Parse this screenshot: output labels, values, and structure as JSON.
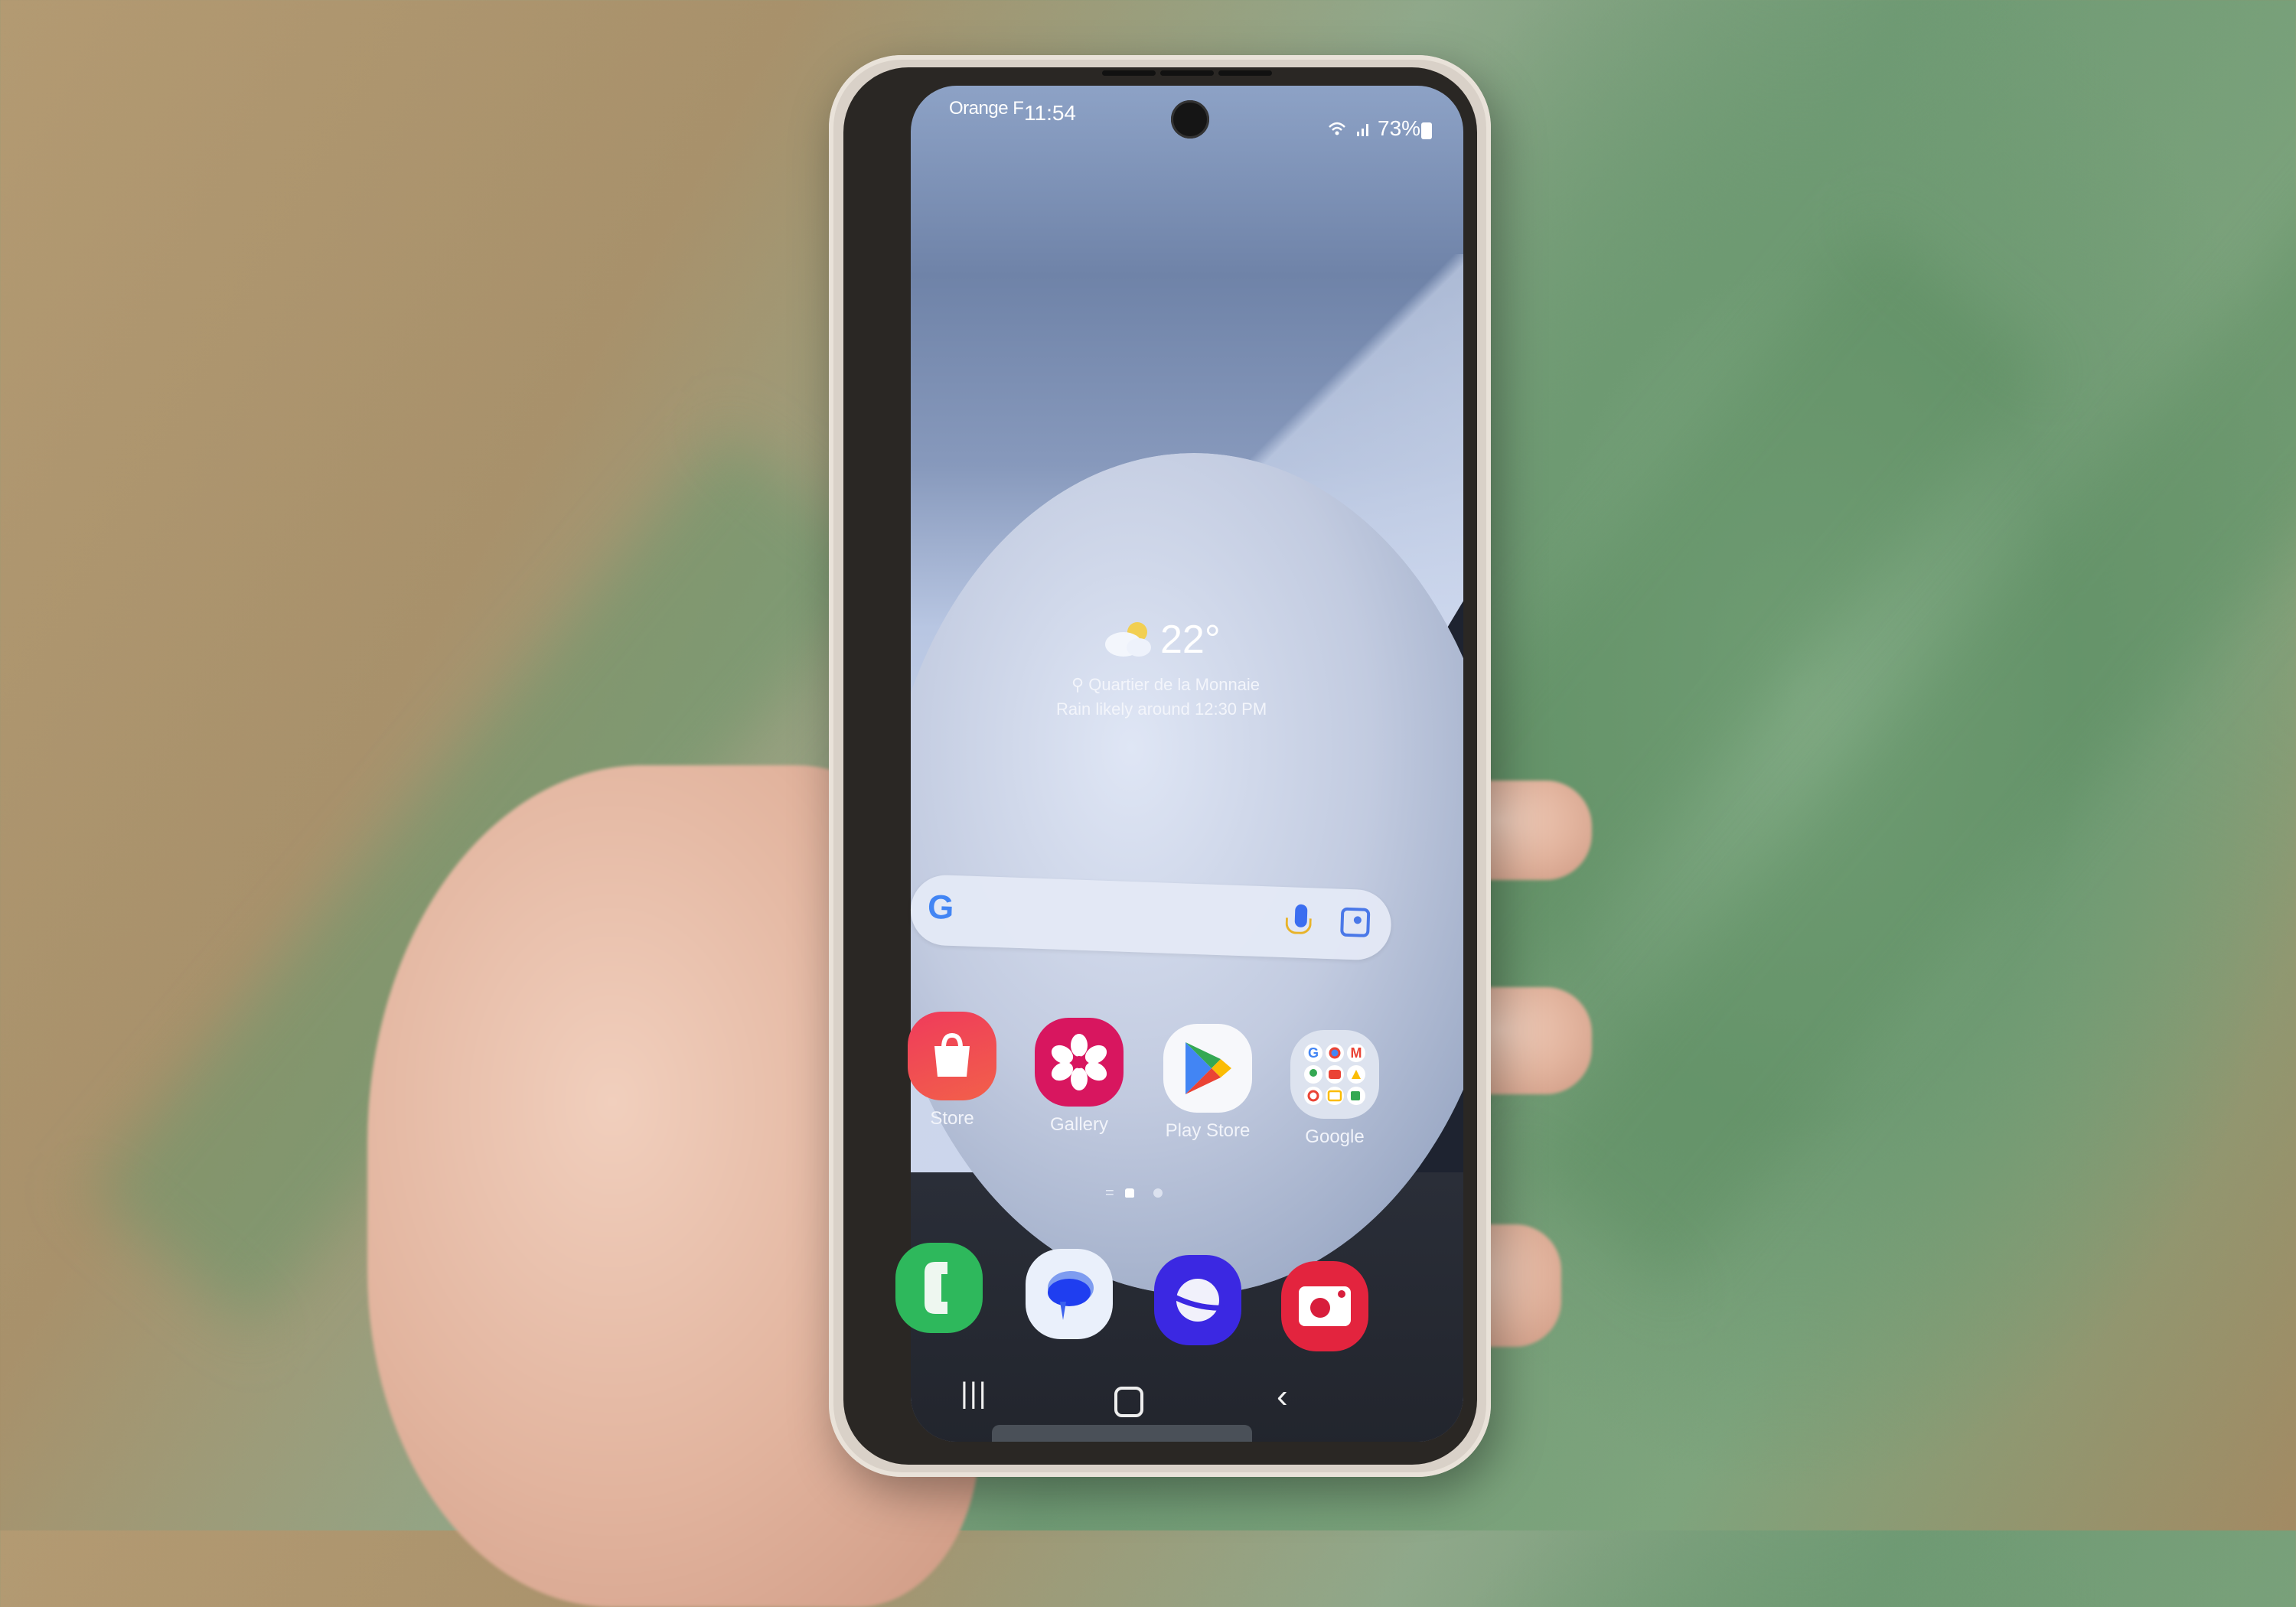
{
  "status_bar": {
    "carrier": "Orange F",
    "time": "11:54",
    "wifi_icon": "wifi-6-icon",
    "signal_icon": "signal-bars-icon",
    "battery_percent": "73%",
    "battery_icon": "battery-icon"
  },
  "weather_widget": {
    "icon": "partly-cloudy-icon",
    "temperature": "22°",
    "location_icon": "location-pin-icon",
    "location": "Quartier de la Monnaie",
    "forecast": "Rain likely around 12:30 PM"
  },
  "search_widget": {
    "logo": "G",
    "mic_icon": "microphone-icon",
    "lens_icon": "google-lens-icon"
  },
  "home_apps": [
    {
      "label": "Store",
      "icon": "shopping-bag-icon",
      "color": "#ef3b5b"
    },
    {
      "label": "Gallery",
      "icon": "flower-icon",
      "color": "#d8165f"
    },
    {
      "label": "Play Store",
      "icon": "play-triangle-icon",
      "color": "#f7f8fb"
    },
    {
      "label": "Google",
      "icon": "folder-icon",
      "color": "#dde3ef"
    }
  ],
  "page_indicator": {
    "pages": 2,
    "current": 1,
    "home_glyph": "home-page-icon",
    "extra_glyph": "="
  },
  "dock_apps": [
    {
      "name": "Phone",
      "icon": "phone-handset-icon",
      "color": "#2eb85c"
    },
    {
      "name": "Messages",
      "icon": "chat-bubble-icon",
      "color": "#1f3ef0"
    },
    {
      "name": "Internet",
      "icon": "planet-icon",
      "color": "#3b28e2"
    },
    {
      "name": "Camera",
      "icon": "camera-icon",
      "color": "#e3243e"
    }
  ],
  "nav_bar": {
    "recents": "|||",
    "back": "‹"
  }
}
